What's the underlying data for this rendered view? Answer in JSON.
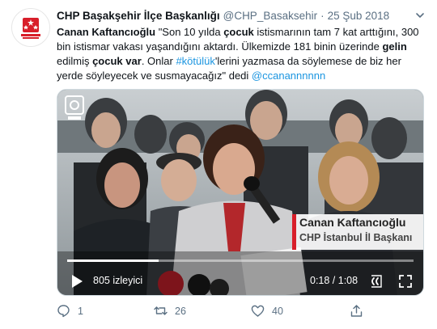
{
  "author": {
    "name": "CHP Başakşehir İlçe Başkanlığı",
    "handle": "@CHP_Basaksehir",
    "separator": "·",
    "date": "25 Şub 2018"
  },
  "tweet_text": {
    "p1": "Canan Kaftancıoğlu",
    "p2": " \"Son 10 yılda ",
    "p3": "çocuk",
    "p4": " istismarının tam 7 kat arttığını, 300 bin istismar vakası yaşandığını aktardı. Ülkemizde 181 binin üzerinde ",
    "p5": "gelin",
    "p6": " edilmiş ",
    "p7": "çocuk",
    "p8": " ",
    "p9": "var",
    "p10": ". Onlar ",
    "hashtag": "#kötülük",
    "p11": "'lerini yazmasa da söylemese de biz her yerde söyleyecek ve susmayacağız\" dedi ",
    "mention": "@ccanannnnnn"
  },
  "video": {
    "lower_third_name": "Canan Kaftancıoğlu",
    "lower_third_title": "CHP İstanbul İl Başkanı",
    "views": "805 izleyici",
    "time": "0:18 / 1:08",
    "progress_fraction": 0.265
  },
  "actions": {
    "reply_count": "1",
    "retweet_count": "26",
    "like_count": "40"
  },
  "colors": {
    "link": "#1b95e0",
    "muted": "#5b7083",
    "chp_red": "#d81e2a"
  },
  "icons": [
    "chp-logo",
    "caret-down-icon",
    "play-icon",
    "captions-icon",
    "fullscreen-icon",
    "reply-icon",
    "retweet-icon",
    "like-icon",
    "share-icon"
  ]
}
